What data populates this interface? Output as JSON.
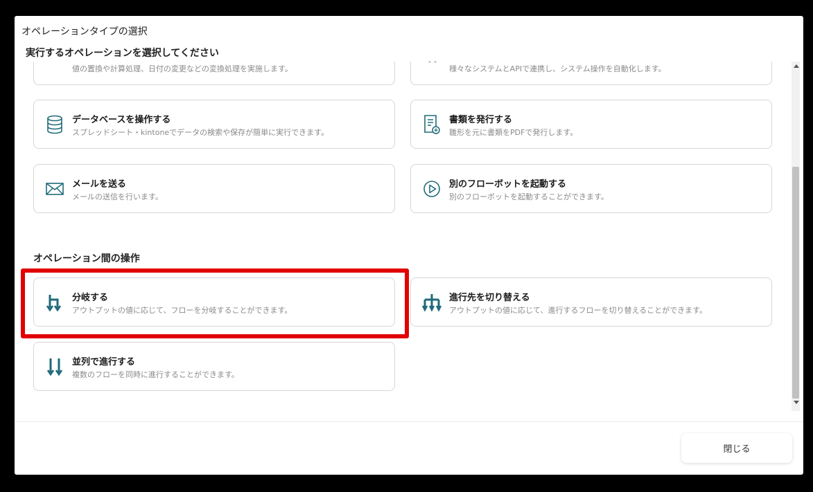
{
  "dialog": {
    "title": "オペレーションタイプの選択",
    "subtitle": "実行するオペレーションを選択してください"
  },
  "cards_top": [
    {
      "icon": "transform-icon",
      "title": "",
      "desc": "値の置換や計算処理、日付の変更などの変換処理を実施します。"
    },
    {
      "icon": "integration-icon",
      "title": "",
      "desc": "様々なシステムとAPIで連携し、システム操作を自動化します。"
    },
    {
      "icon": "database-icon",
      "title": "データベースを操作する",
      "desc": "スプレッドシート・kintoneでデータの検索や保存が簡単に実行できます。"
    },
    {
      "icon": "document-icon",
      "title": "書類を発行する",
      "desc": "雛形を元に書類をPDFで発行します。"
    },
    {
      "icon": "mail-icon",
      "title": "メールを送る",
      "desc": "メールの送信を行います。"
    },
    {
      "icon": "play-icon",
      "title": "別のフローボットを起動する",
      "desc": "別のフローボットを起動することができます。"
    }
  ],
  "section": {
    "heading": "オペレーション間の操作"
  },
  "cards_flow": [
    {
      "icon": "branch-icon",
      "title": "分岐する",
      "desc": "アウトプットの値に応じて、フローを分岐することができます。"
    },
    {
      "icon": "switch-path-icon",
      "title": "進行先を切り替える",
      "desc": "アウトプットの値に応じて、進行するフローを切り替えることができます。"
    },
    {
      "icon": "parallel-icon",
      "title": "並列で進行する",
      "desc": "複数のフローを同時に進行することができます。"
    }
  ],
  "footer": {
    "close_label": "閉じる"
  },
  "colors": {
    "icon": "#1f6a7a",
    "highlight": "#e20000"
  }
}
